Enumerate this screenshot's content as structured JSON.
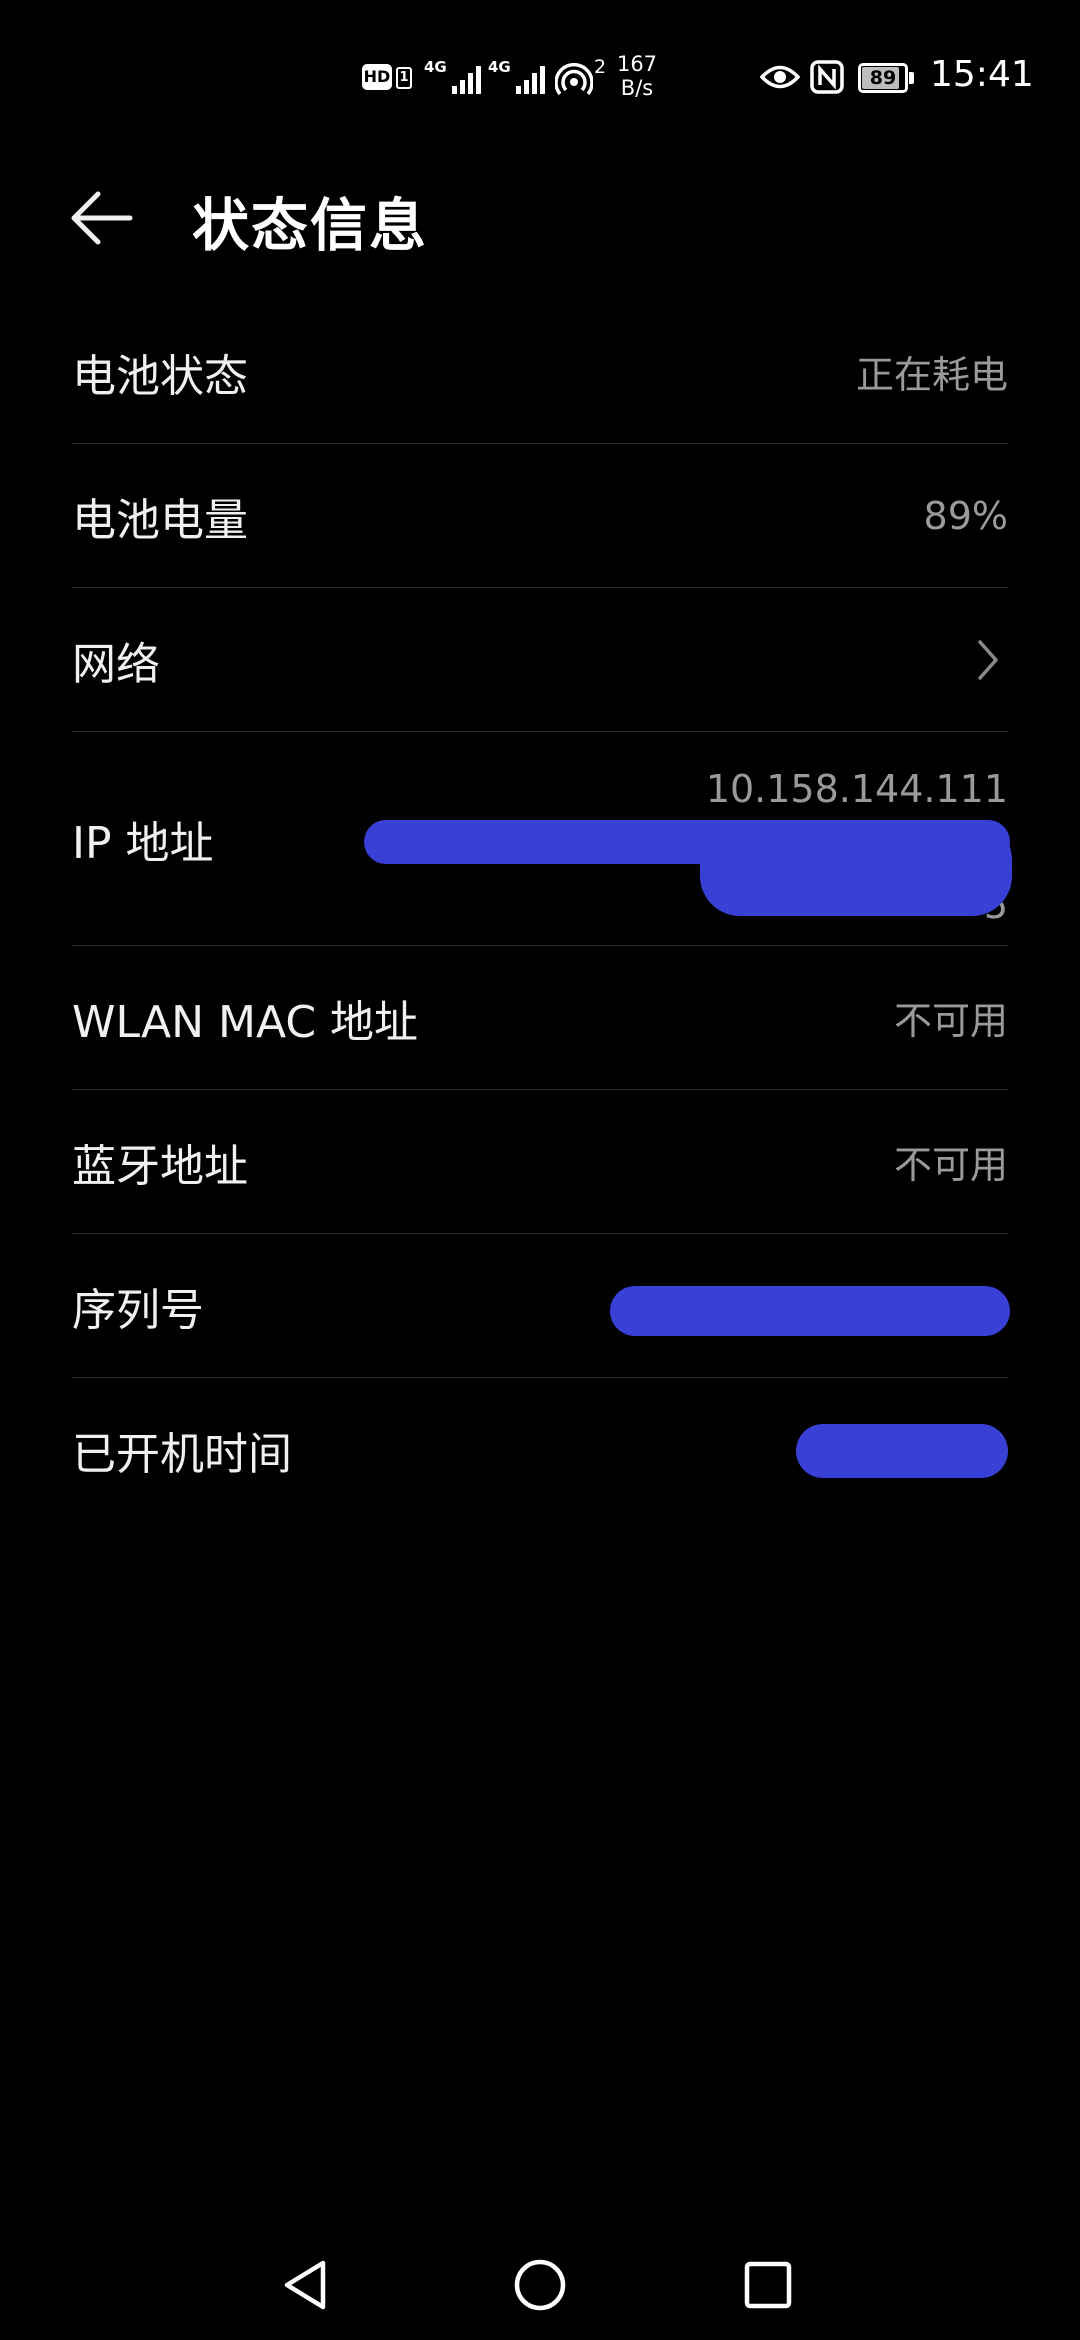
{
  "status_bar": {
    "hd_label": "HD",
    "sim_slot": "1",
    "network_1": "4G",
    "network_2": "4G",
    "hotspot_count": "2",
    "speed_value": "167",
    "speed_unit": "B/s",
    "battery_percent": "89",
    "time": "15:41"
  },
  "header": {
    "title": "状态信息"
  },
  "rows": [
    {
      "label": "电池状态",
      "value": "正在耗电"
    },
    {
      "label": "电池电量",
      "value": "89%"
    },
    {
      "label": "网络",
      "value": ""
    },
    {
      "label": "IP 地址",
      "values": [
        "10.158.144.111",
        "",
        "5"
      ]
    },
    {
      "label": "WLAN MAC 地址",
      "value": "不可用"
    },
    {
      "label": "蓝牙地址",
      "value": "不可用"
    },
    {
      "label": "序列号",
      "value": ""
    },
    {
      "label": "已开机时间",
      "value": ""
    }
  ],
  "colors": {
    "background": "#000000",
    "text_primary": "#f0f0f0",
    "text_secondary": "#9a9a9a",
    "divider": "#2e2e2e",
    "redaction": "#3840d6"
  },
  "icons": {
    "back": "back-arrow-icon",
    "chevron": "chevron-right-icon",
    "nav_back": "nav-back-triangle-icon",
    "nav_home": "nav-home-circle-icon",
    "nav_recent": "nav-recent-square-icon"
  }
}
